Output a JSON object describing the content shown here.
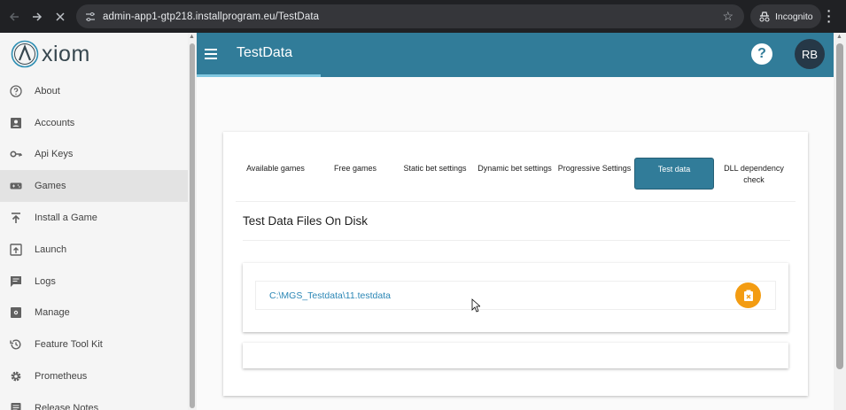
{
  "browser": {
    "url": "admin-app1-gtp218.installprogram.eu/TestData",
    "incognito_label": "Incognito"
  },
  "sidebar": {
    "logo_text": "xiom",
    "items": [
      {
        "label": "About",
        "icon": "help-circle-icon"
      },
      {
        "label": "Accounts",
        "icon": "account-box-icon"
      },
      {
        "label": "Api Keys",
        "icon": "key-icon"
      },
      {
        "label": "Games",
        "icon": "gamepad-icon",
        "active": true
      },
      {
        "label": "Install a Game",
        "icon": "upload-icon"
      },
      {
        "label": "Launch",
        "icon": "launch-icon"
      },
      {
        "label": "Logs",
        "icon": "message-icon"
      },
      {
        "label": "Manage",
        "icon": "settings-box-icon"
      },
      {
        "label": "Feature Tool Kit",
        "icon": "history-icon"
      },
      {
        "label": "Prometheus",
        "icon": "gear-icon"
      },
      {
        "label": "Release Notes",
        "icon": "notes-icon"
      }
    ]
  },
  "header": {
    "title": "TestData",
    "help_label": "?",
    "avatar_initials": "RB"
  },
  "tabs": [
    {
      "label": "Available games"
    },
    {
      "label": "Free games"
    },
    {
      "label": "Static bet settings"
    },
    {
      "label": "Dynamic bet settings"
    },
    {
      "label": "Progressive Settings"
    },
    {
      "label": "Test data",
      "active": true
    },
    {
      "label": "DLL dependency check"
    }
  ],
  "section": {
    "title": "Test Data Files On Disk"
  },
  "files": [
    {
      "path": "C:\\MGS_Testdata\\11.testdata"
    }
  ],
  "colors": {
    "primary": "#317c99",
    "accent": "#f39c12",
    "link": "#2a86b5"
  }
}
